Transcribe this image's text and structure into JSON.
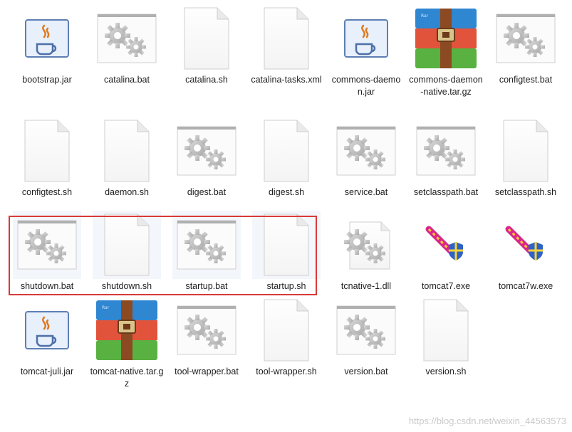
{
  "files": [
    {
      "name": "bootstrap.jar",
      "type": "java-icon"
    },
    {
      "name": "catalina.bat",
      "type": "bat-icon"
    },
    {
      "name": "catalina.sh",
      "type": "sh-icon"
    },
    {
      "name": "catalina-tasks.xml",
      "type": "sh-icon"
    },
    {
      "name": "commons-daemon.jar",
      "type": "java-icon"
    },
    {
      "name": "commons-daemon-native.tar.gz",
      "type": "archive-icon"
    },
    {
      "name": "configtest.bat",
      "type": "bat-icon"
    },
    {
      "name": "configtest.sh",
      "type": "sh-icon"
    },
    {
      "name": "daemon.sh",
      "type": "sh-icon"
    },
    {
      "name": "digest.bat",
      "type": "bat-icon"
    },
    {
      "name": "digest.sh",
      "type": "sh-icon"
    },
    {
      "name": "service.bat",
      "type": "bat-icon"
    },
    {
      "name": "setclasspath.bat",
      "type": "bat-icon"
    },
    {
      "name": "setclasspath.sh",
      "type": "sh-icon"
    },
    {
      "name": "shutdown.bat",
      "type": "bat-icon"
    },
    {
      "name": "shutdown.sh",
      "type": "sh-icon"
    },
    {
      "name": "startup.bat",
      "type": "bat-icon"
    },
    {
      "name": "startup.sh",
      "type": "sh-icon"
    },
    {
      "name": "tcnative-1.dll",
      "type": "dll-icon"
    },
    {
      "name": "tomcat7.exe",
      "type": "tomcat-icon"
    },
    {
      "name": "tomcat7w.exe",
      "type": "tomcat-icon"
    },
    {
      "name": "tomcat-juli.jar",
      "type": "java-icon"
    },
    {
      "name": "tomcat-native.tar.gz",
      "type": "archive-icon"
    },
    {
      "name": "tool-wrapper.bat",
      "type": "bat-icon"
    },
    {
      "name": "tool-wrapper.sh",
      "type": "sh-icon"
    },
    {
      "name": "version.bat",
      "type": "bat-icon"
    },
    {
      "name": "version.sh",
      "type": "sh-icon"
    }
  ],
  "watermark": "https://blog.csdn.net/weixin_44563573"
}
